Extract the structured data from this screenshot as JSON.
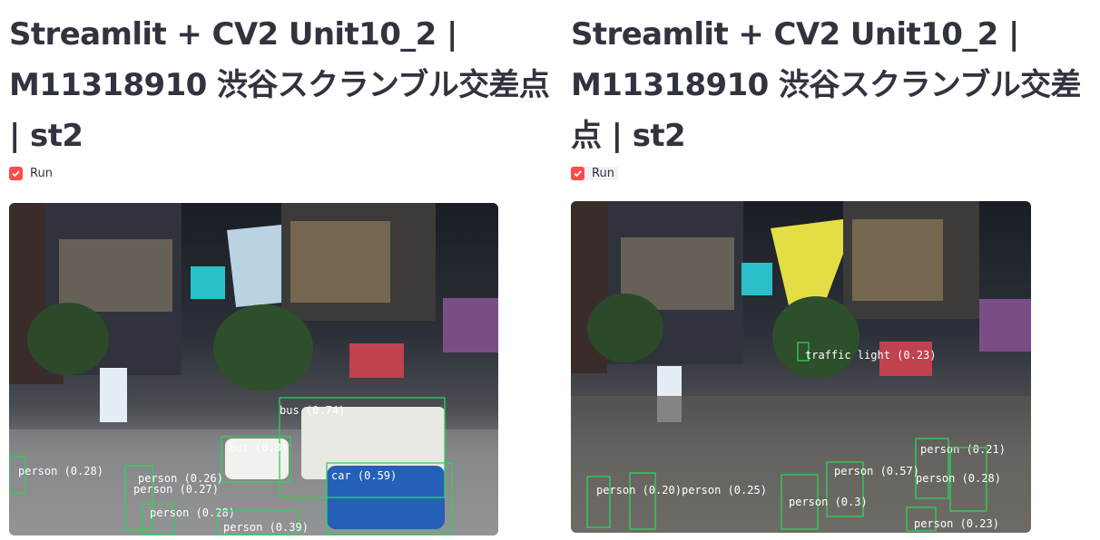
{
  "app": {
    "title": "Streamlit + CV2 Unit10_2 | M11318910 渋谷スクランブル交差点 | st2",
    "run_label": "Run",
    "run_checked": true,
    "accent_color": "#ff4b4b",
    "box_color": "#2fd25a"
  },
  "frames": [
    {
      "detections": [
        {
          "label": "bus (0.74)"
        },
        {
          "label": "bus (0.3)"
        },
        {
          "label": "car (0.59)"
        },
        {
          "label": "person (0.28)"
        },
        {
          "label": "person (0.26)"
        },
        {
          "label": "person (0.27)"
        },
        {
          "label": "person (0.28)"
        },
        {
          "label": "person (0.39)"
        }
      ]
    },
    {
      "detections": [
        {
          "label": "traffic light (0.23)"
        },
        {
          "label": "person (0.21)"
        },
        {
          "label": "person (0.28)"
        },
        {
          "label": "person (0.57)"
        },
        {
          "label": "person (0.3)"
        },
        {
          "label": "person (0.25)"
        },
        {
          "label": "person (0.20)"
        },
        {
          "label": "person (0.23)"
        }
      ]
    }
  ]
}
